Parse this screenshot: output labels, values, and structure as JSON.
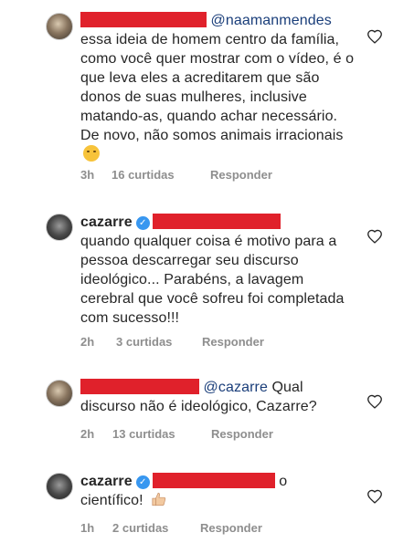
{
  "comments": [
    {
      "mention": "@naamanmendes",
      "text": "essa ideia de homem centro da família, como você quer mostrar com o vídeo, é o que leva eles a acreditarem que são donos de suas mulheres, inclusive matando-as, quando achar necessário. De novo, não somos animais irracionais",
      "emoji": "winking-face",
      "time": "3h",
      "likes": "16 curtidas",
      "reply": "Responder"
    },
    {
      "username": "cazarre",
      "text": "quando qualquer coisa é motivo para a pessoa descarregar seu discurso ideológico... Parabéns, a lavagem cerebral que você sofreu foi completada com sucesso!!!",
      "time": "2h",
      "likes": "3 curtidas",
      "reply": "Responder"
    },
    {
      "mention": "@cazarre",
      "text_inline": "Qual",
      "text": "discurso não é ideológico, Cazarre?",
      "time": "2h",
      "likes": "13 curtidas",
      "reply": "Responder"
    },
    {
      "username": "cazarre",
      "text_inline": "o",
      "text": "científico!",
      "emoji": "thumbs-up",
      "time": "1h",
      "likes": "2 curtidas",
      "reply": "Responder"
    }
  ],
  "colors": {
    "redaction": "#e0212b",
    "mention": "#1a3e7a",
    "meta": "#8e8e8e",
    "verified": "#3897f0"
  }
}
